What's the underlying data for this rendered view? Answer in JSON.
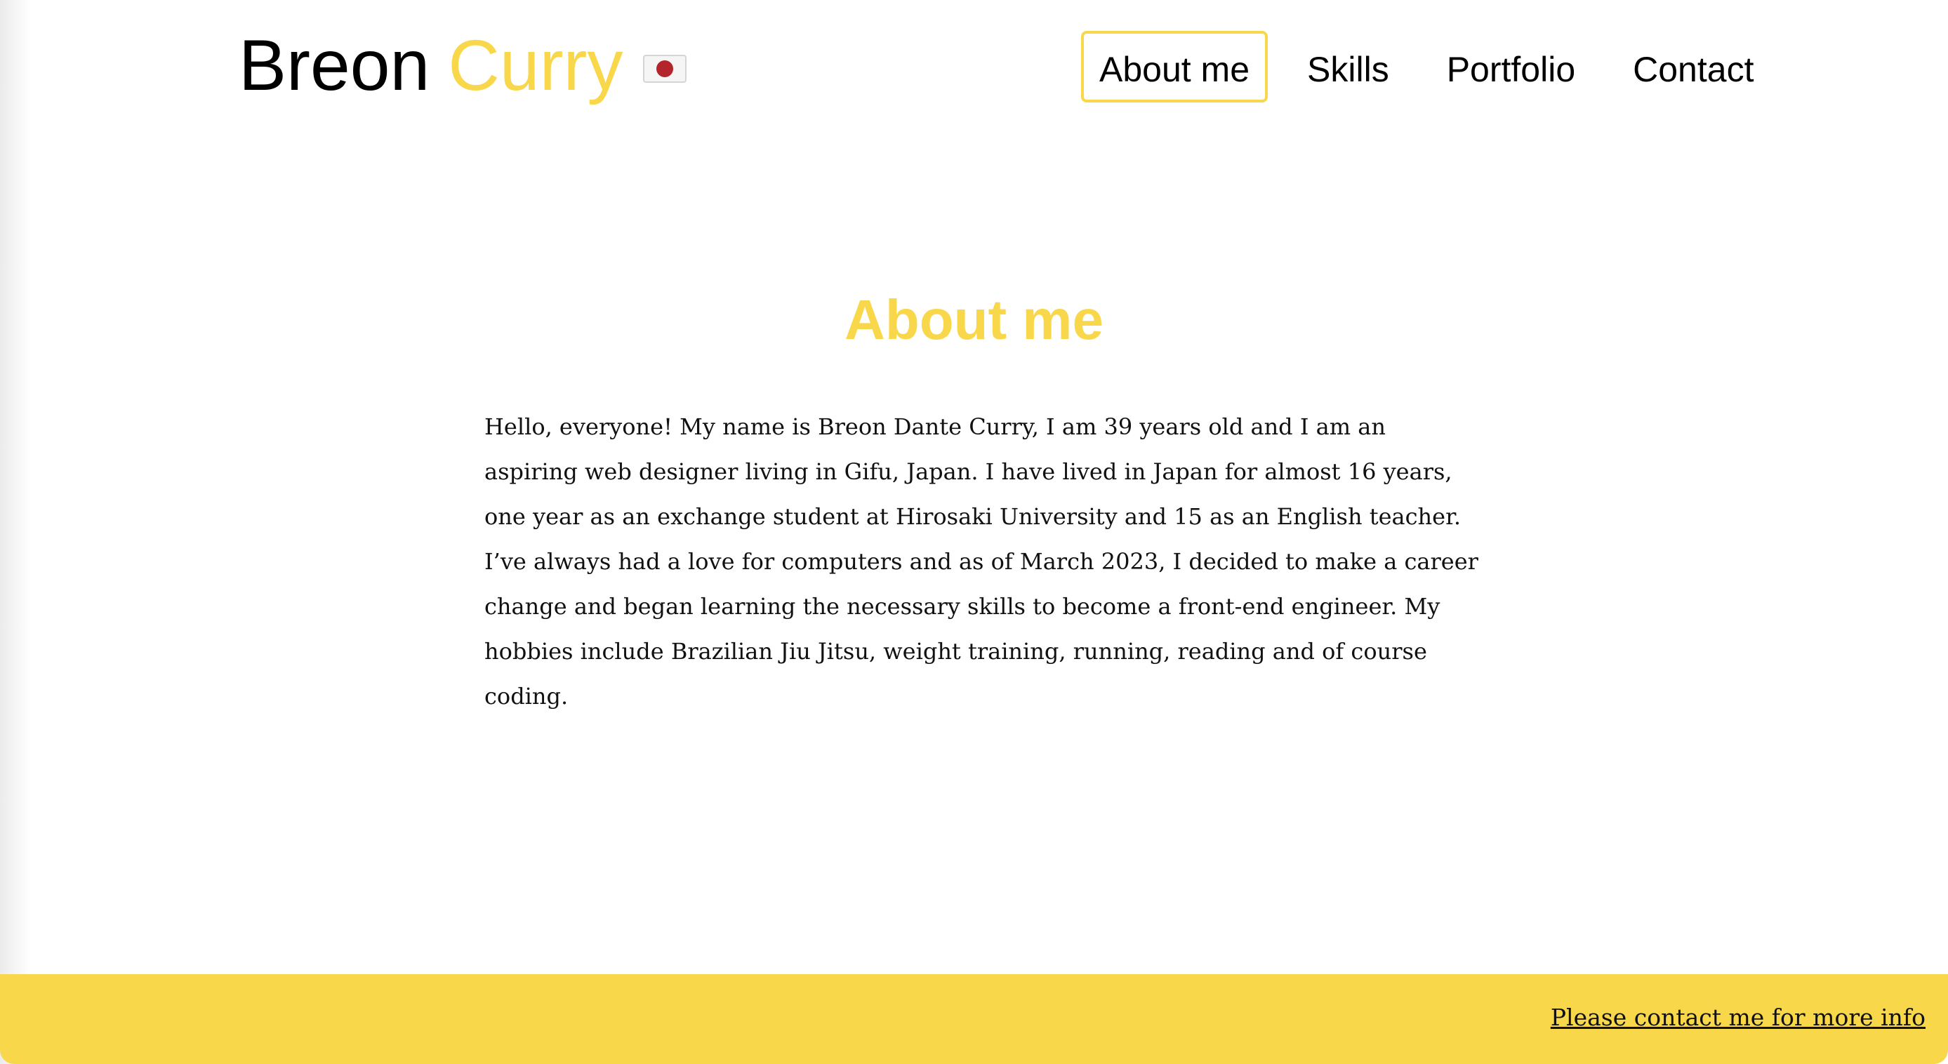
{
  "header": {
    "brand_first": "Breon",
    "brand_last": "Curry",
    "language_flag_icon": "japan-flag-icon",
    "nav": [
      {
        "label": "About me",
        "active": true
      },
      {
        "label": "Skills",
        "active": false
      },
      {
        "label": "Portfolio",
        "active": false
      },
      {
        "label": "Contact",
        "active": false
      }
    ]
  },
  "about": {
    "title": "About me",
    "body": "Hello, everyone! My name is Breon Dante Curry, I am 39 years old and I am an aspiring web designer living in Gifu, Japan. I have lived in Japan for almost 16 years, one year as an exchange student at Hirosaki University and 15 as an English teacher. I’ve always had a love for computers and as of March 2023, I decided to make a career change and began learning the necessary skills to become a front-end engineer. My hobbies include Brazilian Jiu Jitsu, weight training, running, reading and of course coding."
  },
  "footer": {
    "contact_link": "Please contact me for more info"
  },
  "colors": {
    "accent": "#f8d84a",
    "flag_red": "#b3242b",
    "text": "#000000",
    "background": "#ffffff"
  }
}
